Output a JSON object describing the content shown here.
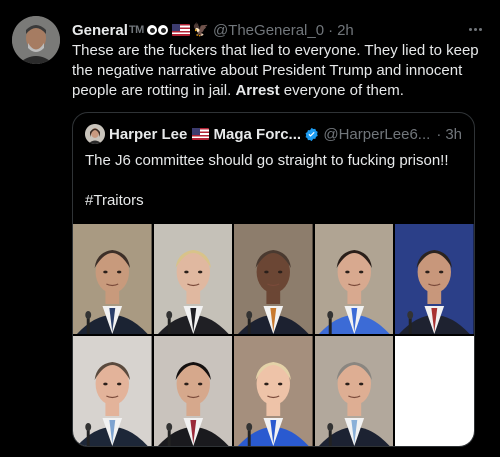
{
  "tweet": {
    "display_name": "General",
    "tm": "TM",
    "eagle_emoji": "🦅",
    "handle": "@TheGeneral_0",
    "dot": "·",
    "time": "2h",
    "text_part1": "These are the fuckers that lied to everyone. They lied to keep the negative narrative about President Trump and innocent people are rotting in jail. ",
    "text_bold": "Arrest",
    "text_part2": " everyone of them."
  },
  "quote": {
    "display_name": "Harper Lee",
    "name_suffix": "Maga Forc...",
    "handle": "@HarperLee6...",
    "dot": "·",
    "time": "3h",
    "text": "The J6 committee should go straight to fucking prison!!",
    "hashtag": "#Traitors"
  },
  "images": [
    {
      "name": "portrait-1",
      "bg": "#a99a82",
      "skin": "#c89a7c",
      "hair": "#3d2f28",
      "suit": "#1b2333",
      "tie": "#2b3f6b"
    },
    {
      "name": "portrait-2",
      "bg": "#c5c1b8",
      "skin": "#e0b8a0",
      "hair": "#d8c38a",
      "suit": "#1f1f24",
      "tie": "#1f1f24"
    },
    {
      "name": "portrait-3",
      "bg": "#8d7d6c",
      "skin": "#6b4634",
      "hair": "#4a3a30",
      "suit": "#1c2130",
      "tie": "#c87a30"
    },
    {
      "name": "portrait-4",
      "bg": "#b0a493",
      "skin": "#d8a98f",
      "hair": "#2a1f1a",
      "suit": "#3c6bd6",
      "tie": "#3c6bd6"
    },
    {
      "name": "portrait-5",
      "bg": "#2b3f88",
      "skin": "#c8977b",
      "hair": "#2a2320",
      "suit": "#1e2230",
      "tie": "#a83232"
    },
    {
      "name": "portrait-6",
      "bg": "#d7d3cf",
      "skin": "#e3b39a",
      "hair": "#5a4a3e",
      "suit": "#1d2738",
      "tie": "#7ea3d0"
    },
    {
      "name": "portrait-7",
      "bg": "#c9c3bd",
      "skin": "#d6a88c",
      "hair": "#141010",
      "suit": "#1a1a1e",
      "tie": "#9a2a3a"
    },
    {
      "name": "portrait-8",
      "bg": "#a58f7d",
      "skin": "#eec3a8",
      "hair": "#e4d2a8",
      "suit": "#2a5ad0",
      "tie": "#2a5ad0"
    },
    {
      "name": "portrait-9",
      "bg": "#b2a89c",
      "skin": "#deae93",
      "hair": "#8a8680",
      "suit": "#1c2232",
      "tie": "#8ab0d8"
    }
  ]
}
